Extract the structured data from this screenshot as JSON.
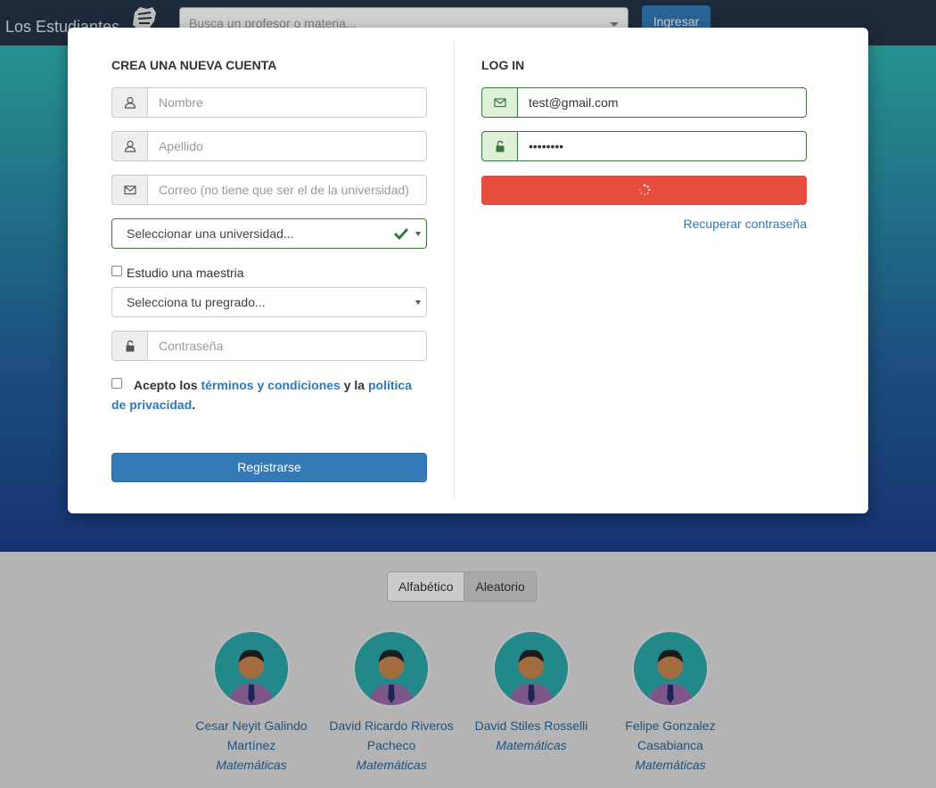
{
  "navbar": {
    "brand": "Los Estudiantes",
    "search_placeholder": "Busca un profesor o materia...",
    "login_button": "Ingresar"
  },
  "signup": {
    "title": "CREA UNA NUEVA CUENTA",
    "first_name_placeholder": "Nombre",
    "last_name_placeholder": "Apellido",
    "email_placeholder": "Correo (no tiene que ser el de la universidad)",
    "university_select": "Seleccionar una universidad...",
    "masters_label": "Estudio una maestria",
    "degree_select": "Selecciona tu pregrado...",
    "password_placeholder": "Contraseña",
    "terms_prefix": "Acepto los",
    "terms_link": "términos y condiciones",
    "terms_middle": "y la",
    "privacy_link": "política de privacidad",
    "terms_suffix": ".",
    "submit": "Registrarse"
  },
  "login": {
    "title": "LOG IN",
    "email_value": "test@gmail.com",
    "password_value": "••••••••",
    "recover_link": "Recuperar contraseña"
  },
  "sort": {
    "options": [
      "Alfabético",
      "Aleatorio"
    ],
    "active": "Aleatorio"
  },
  "professors": [
    {
      "name": "Cesar Neyit Galindo Martínez",
      "subject": "Matemáticas"
    },
    {
      "name": "David Ricardo Riveros Pacheco",
      "subject": "Matemáticas"
    },
    {
      "name": "David Stiles Rosselli",
      "subject": "Matemáticas"
    },
    {
      "name": "Felipe Gonzalez Casabianca",
      "subject": "Matemáticas"
    }
  ],
  "icons": {
    "user": "user-icon",
    "envelope": "envelope-icon",
    "lock": "unlock-icon",
    "check": "check-icon",
    "spinner": "spinner-icon"
  },
  "colors": {
    "primary": "#337ab7",
    "danger": "#e84c3d",
    "success": "#3c763d",
    "navbar": "#243447"
  }
}
